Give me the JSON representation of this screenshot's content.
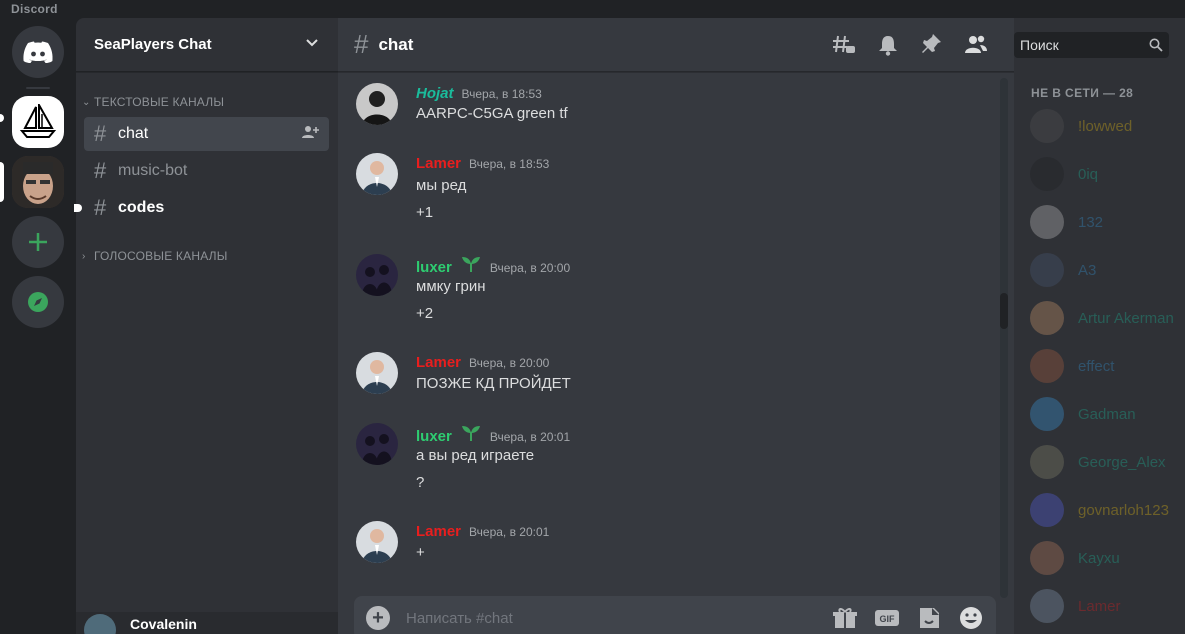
{
  "app": {
    "title": "Discord"
  },
  "guild": {
    "name": "SeaPlayers Chat"
  },
  "categories": {
    "text": "ТЕКСТОВЫЕ КАНАЛЫ",
    "voice": "ГОЛОСОВЫЕ КАНАЛЫ"
  },
  "channels": [
    {
      "name": "chat",
      "state": "active"
    },
    {
      "name": "music-bot",
      "state": "muted"
    },
    {
      "name": "codes",
      "state": "unread"
    }
  ],
  "user_panel": {
    "username": "Covalenin"
  },
  "chat": {
    "channel_name": "chat",
    "composer_placeholder": "Написать #chat"
  },
  "header": {
    "search_placeholder": "Поиск"
  },
  "messages": [
    {
      "author": "Hojat",
      "color": "#1abc9c",
      "italic": true,
      "time": "Вчера, в 18:53",
      "lines": [
        "AARPC-C5GA green tf"
      ],
      "avatar": "dark"
    },
    {
      "author": "Lamer",
      "color": "#e91e1e",
      "italic": false,
      "time": "Вчера, в 18:53",
      "lines": [
        "мы ред",
        "+1"
      ],
      "avatar": "suit"
    },
    {
      "author": "luxer",
      "color": "#2ecc71",
      "italic": false,
      "sprout": true,
      "time": "Вчера, в 20:00",
      "lines": [
        "ммку грин",
        "+2"
      ],
      "avatar": "night"
    },
    {
      "author": "Lamer",
      "color": "#e91e1e",
      "italic": false,
      "time": "Вчера, в 20:00",
      "lines": [
        "ПОЗЖЕ КД ПРОЙДЕТ"
      ],
      "avatar": "suit"
    },
    {
      "author": "luxer",
      "color": "#2ecc71",
      "italic": false,
      "sprout": true,
      "time": "Вчера, в 20:01",
      "lines": [
        "а вы ред играете",
        "?"
      ],
      "avatar": "night"
    },
    {
      "author": "Lamer",
      "color": "#e91e1e",
      "italic": false,
      "time": "Вчера, в 20:01",
      "lines": [
        "+"
      ],
      "avatar": "suit"
    }
  ],
  "members": {
    "offline_header": "НЕ В СЕТИ — 28",
    "list": [
      {
        "name": "!lowwed",
        "color": "#f1c40f",
        "avatar": "#555"
      },
      {
        "name": "0iq",
        "color": "#1abc9c",
        "avatar": "#1e1f22"
      },
      {
        "name": "132",
        "color": "#3498db",
        "avatar": "#c8c8c8"
      },
      {
        "name": "A3",
        "color": "#3498db",
        "avatar": "#4a5a78"
      },
      {
        "name": "Artur Akerman",
        "color": "#1abc9c",
        "avatar": "#d8a070"
      },
      {
        "name": "effect",
        "color": "#3498db",
        "avatar": "#b06040"
      },
      {
        "name": "Gadman",
        "color": "#1abc9c",
        "avatar": "#3aa0e8"
      },
      {
        "name": "George_Alex",
        "color": "#1abc9c",
        "avatar": "#8a8a70"
      },
      {
        "name": "govnarloh123",
        "color": "#f1c40f",
        "avatar": "#5865f2"
      },
      {
        "name": "Kayxu",
        "color": "#1abc9c",
        "avatar": "#c08060"
      },
      {
        "name": "Lamer",
        "color": "#e91e1e",
        "avatar": "#8aa0b8"
      }
    ]
  }
}
